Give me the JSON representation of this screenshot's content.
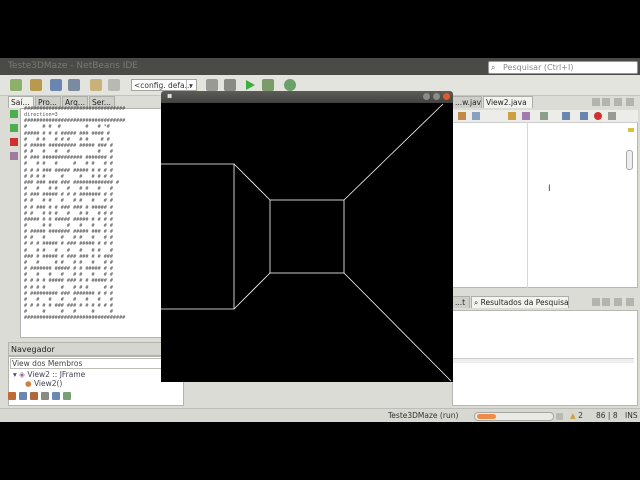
{
  "ide": {
    "title_text": "Teste3DMaze - NetBeans IDE",
    "search": {
      "icon": "search-icon",
      "placeholder": "Pesquisar (Ctrl+I)"
    },
    "toolbar": {
      "config": "<config. defa...",
      "dropdown_arrow": "▾"
    },
    "left_tabs": [
      "Saí...",
      "Pro...",
      "Arq...",
      "Ser..."
    ],
    "editor_tabs": [
      "...w.java",
      "View2.java"
    ],
    "output": {
      "lines": [
        "#################################",
        "direction=3",
        "#################################",
        "#     # #  #        #   # *#",
        "##### # # # ##### ### #### #",
        "#   # #   # # #   # #    # #",
        "# ##### ######### ##### ### #",
        "# #   #   #   #         #   #",
        "# ### ############# ####### #",
        "#   # #   #     #   # #   # #",
        "# # # ### ##### ##### # # # #",
        "# # # #     #     #   # # # #",
        "### ### ### ### ############# #",
        "#   #   # #   #   # #   #   #",
        "# ### ##### # # # ####### # #",
        "# #   # #   #   # #   #   # #",
        "# # ### # # ### ### # ##### #",
        "# #   # # #   #   # #   # # #",
        "##### # # ##### ##### # # # #",
        "#     # #     #   #   #   # #",
        "# ##### ####### ##### ### # #",
        "# #   #     #   # #   #   # #",
        "# # # ##### # ### ##### # # #",
        "#   # #   #   #   #   # #   #",
        "### # ##### # ### ### # # ###",
        "#   #     # #   # #   #   # #",
        "# ####### ##### # # ##### # #",
        "#   #   #   #   # #   #   # #",
        "# # # # ##### ### # # ##### #",
        "# # # #     #   # # #     # #",
        "# ######### ### ####### # # #",
        "#   #   #   #   #   #   #   #",
        "# # # # # ### ### # # # # # #",
        "#     #     #   #     #     #",
        "#################################"
      ]
    },
    "navigator": {
      "header": "Navegador",
      "members_filter": "View dos Membros",
      "class_node": "View2 :: JFrame",
      "method_node": "View2()"
    },
    "bottom_tabs": {
      "left": "...t",
      "search_results": "Resultados da Pesquisa"
    },
    "status": {
      "run_label": "Teste3DMaze (run)",
      "progress": 0.25,
      "warnings": "2",
      "position": "86 | 8",
      "mode": "INS"
    }
  },
  "maze_window": {
    "menu_glyph": "▪",
    "close_color": "#e05a2b",
    "btn_color": "#8a8a86"
  },
  "colors": {
    "accent_orange": "#f08a4a",
    "run_green": "#3cae3c",
    "debug_red": "#d03030"
  }
}
